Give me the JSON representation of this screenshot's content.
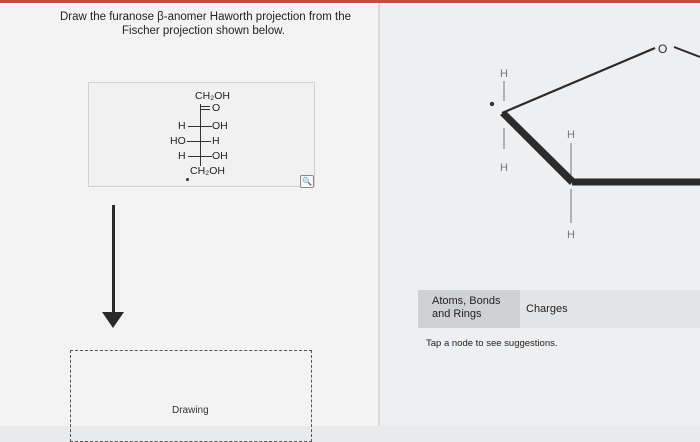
{
  "question": {
    "line1": "Draw the furanose β-anomer Haworth projection from the",
    "line2": "Fischer projection shown below."
  },
  "fischer": {
    "top": "CH₂OH",
    "carbonyl": "O",
    "row1_left": "H",
    "row1_right": "OH",
    "row2_left": "HO",
    "row2_right": "H",
    "row3_left": "H",
    "row3_right": "OH",
    "bottom": "CH₂OH"
  },
  "zoom_icon": "magnify-icon",
  "drawing_area": {
    "label": "Drawing"
  },
  "canvas": {
    "h_top": "H",
    "h_mid": "H",
    "h_right_top": "H",
    "h_right_bottom": "H",
    "ring_oxygen": "O"
  },
  "tools": {
    "atoms_bonds_rings": "Atoms, Bonds and Rings",
    "charges": "Charges",
    "hint": "Tap a node to see suggestions."
  }
}
